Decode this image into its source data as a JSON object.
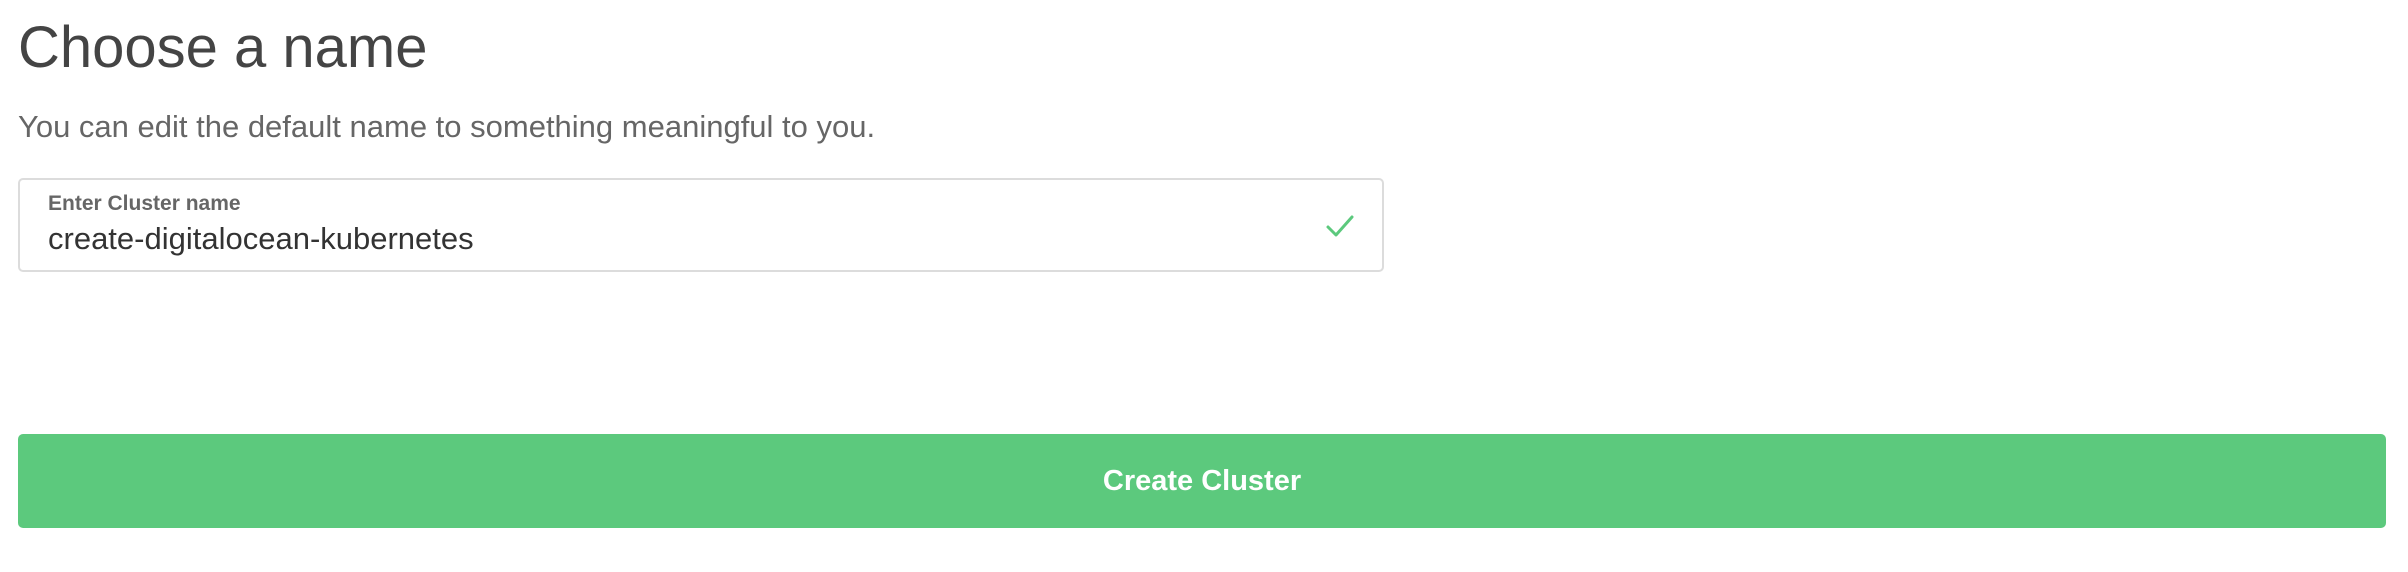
{
  "section": {
    "title": "Choose a name",
    "subtitle": "You can edit the default name to something meaningful to you."
  },
  "cluster_name_field": {
    "label": "Enter Cluster name",
    "value": "create-digitalocean-kubernetes",
    "status_icon": "check-icon"
  },
  "actions": {
    "create_label": "Create Cluster"
  },
  "colors": {
    "primary_green": "#5cc97d",
    "valid_check": "#5cc97d",
    "heading_text": "#444444",
    "body_text": "#666666",
    "field_border": "#dcdcdc"
  }
}
